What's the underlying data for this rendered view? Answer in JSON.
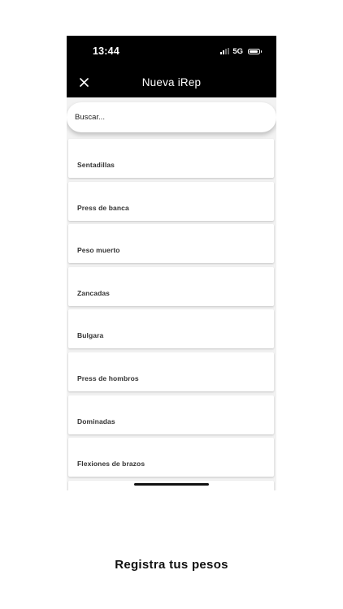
{
  "status_bar": {
    "time": "13:44",
    "network": "5G",
    "icons": [
      "signal-icon",
      "battery-icon"
    ]
  },
  "nav": {
    "title": "Nueva iRep",
    "close_icon": "close-icon"
  },
  "search": {
    "placeholder": "Buscar..."
  },
  "exercises": [
    {
      "label": "Sentadillas"
    },
    {
      "label": "Press de banca"
    },
    {
      "label": "Peso muerto"
    },
    {
      "label": "Zancadas"
    },
    {
      "label": "Bulgara"
    },
    {
      "label": "Press de hombros"
    },
    {
      "label": "Dominadas"
    },
    {
      "label": "Flexiones de brazos"
    },
    {
      "label": ""
    }
  ],
  "caption": "Registra tus pesos",
  "colors": {
    "header_bg": "#000000",
    "header_text": "#ffffff",
    "list_bg": "#f2f2f2",
    "item_bg": "#ffffff",
    "item_text": "#333333"
  }
}
